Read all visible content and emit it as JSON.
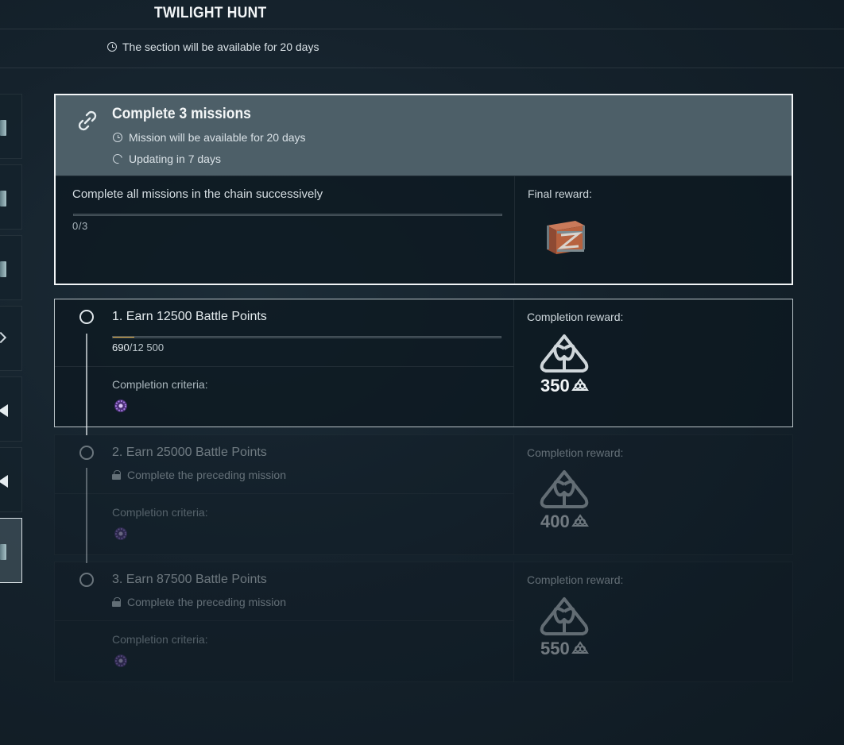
{
  "header": {
    "title": "TWILIGHT HUNT",
    "section_timer": "The section will be available for 20 days"
  },
  "chain": {
    "title": "Complete 3 missions",
    "mission_timer": "Mission will be available for 20 days",
    "update_timer": "Updating in 7 days",
    "description": "Complete all missions in the chain successively",
    "progress_text": "0/3",
    "progress_fraction": 0,
    "final_reward_label": "Final reward:"
  },
  "missions": [
    {
      "title": "1. Earn 12500 Battle Points",
      "progress_current": "690",
      "progress_total": "/12 500",
      "progress_fraction": 0.0552,
      "criteria_label": "Completion criteria:",
      "reward_label": "Completion reward:",
      "reward_amount": "350"
    },
    {
      "title": "2. Earn 25000 Battle Points",
      "lock_text": "Complete the preceding mission",
      "criteria_label": "Completion criteria:",
      "reward_label": "Completion reward:",
      "reward_amount": "400"
    },
    {
      "title": "3. Earn 87500 Battle Points",
      "lock_text": "Complete the preceding mission",
      "criteria_label": "Completion criteria:",
      "reward_label": "Completion reward:",
      "reward_amount": "550"
    }
  ],
  "colors": {
    "progress_fill": "#e0a83c",
    "chain_header_bg": "#4d5f68",
    "criteria_icon": "#8a5cc8"
  },
  "icons": {
    "chain": "link-icon",
    "clock": "clock-icon",
    "update": "refresh-icon",
    "lock": "lock-icon",
    "final_reward": "crate-icon",
    "reward": "coal-icon",
    "criteria": "purple-gear-icon"
  }
}
